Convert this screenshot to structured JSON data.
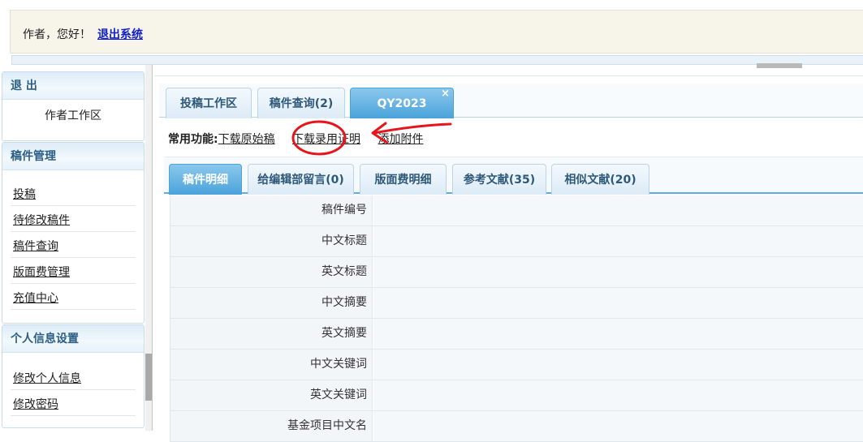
{
  "header": {
    "greeting": "作者，您好！",
    "logout_link": "退出系统"
  },
  "sidebar": {
    "exit_panel": {
      "title": "退 出",
      "items": [
        "作者工作区"
      ]
    },
    "manuscript_panel": {
      "title": "稿件管理",
      "items": [
        "投稿",
        "待修改稿件",
        "稿件查询",
        "版面费管理",
        "充值中心"
      ]
    },
    "profile_panel": {
      "title": "个人信息设置",
      "items": [
        "修改个人信息",
        "修改密码"
      ]
    }
  },
  "main_tabs": [
    {
      "label": "投稿工作区"
    },
    {
      "label": "稿件查询(2)"
    },
    {
      "label": "QY2023",
      "active": true,
      "close": "×"
    }
  ],
  "functions": {
    "label": "常用功能:",
    "links": [
      "下载原始稿",
      "下载录用证明",
      "添加附件"
    ]
  },
  "sub_tabs": [
    {
      "label": "稿件明细",
      "active": true
    },
    {
      "label": "给编辑部留言(0)"
    },
    {
      "label": "版面费明细"
    },
    {
      "label": "参考文献(35)"
    },
    {
      "label": "相似文献(20)"
    }
  ],
  "detail_rows": [
    {
      "label": "稿件编号",
      "value": ""
    },
    {
      "label": "中文标题",
      "value": ""
    },
    {
      "label": "英文标题",
      "value": ""
    },
    {
      "label": "中文摘要",
      "value": ""
    },
    {
      "label": "英文摘要",
      "value": ""
    },
    {
      "label": "中文关键词",
      "value": ""
    },
    {
      "label": "英文关键词",
      "value": ""
    },
    {
      "label": "基金项目中文名",
      "value": ""
    }
  ],
  "colors": {
    "accent": "#4aa3db",
    "annotation": "#e8141b",
    "link": "#1020c8"
  }
}
